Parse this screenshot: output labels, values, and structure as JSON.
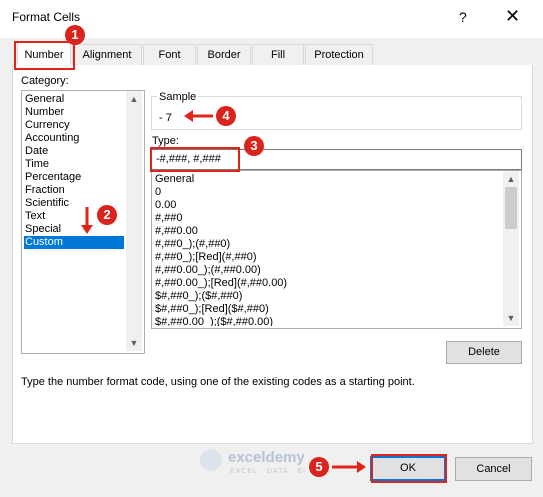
{
  "window": {
    "title": "Format Cells",
    "help_glyph": "?",
    "close_glyph": "✕"
  },
  "tabs": [
    {
      "label": "Number",
      "active": true
    },
    {
      "label": "Alignment"
    },
    {
      "label": "Font"
    },
    {
      "label": "Border"
    },
    {
      "label": "Fill"
    },
    {
      "label": "Protection"
    }
  ],
  "category": {
    "label": "Category:",
    "items": [
      "General",
      "Number",
      "Currency",
      "Accounting",
      "Date",
      "Time",
      "Percentage",
      "Fraction",
      "Scientific",
      "Text",
      "Special",
      "Custom"
    ],
    "selected": "Custom"
  },
  "sample": {
    "label": "Sample",
    "value": "- 7"
  },
  "type": {
    "label": "Type:",
    "value": "-#,###, #,###",
    "formats": [
      "General",
      "0",
      "0.00",
      "#,##0",
      "#,##0.00",
      "#,##0_);(#,##0)",
      "#,##0_);[Red](#,##0)",
      "#,##0.00_);(#,##0.00)",
      "#,##0.00_);[Red](#,##0.00)",
      "$#,##0_);($#,##0)",
      "$#,##0_);[Red]($#,##0)",
      "$#,##0.00_);($#,##0.00)"
    ]
  },
  "buttons": {
    "delete": "Delete",
    "ok": "OK",
    "cancel": "Cancel"
  },
  "description": "Type the number format code, using one of the existing codes as a starting point.",
  "annotations": [
    "1",
    "2",
    "3",
    "4",
    "5"
  ],
  "watermark": {
    "name": "exceldemy",
    "tagline": "EXCEL · DATA · BI"
  },
  "colors": {
    "annotation_red": "#e0241b",
    "selection_blue": "#0078d7"
  }
}
